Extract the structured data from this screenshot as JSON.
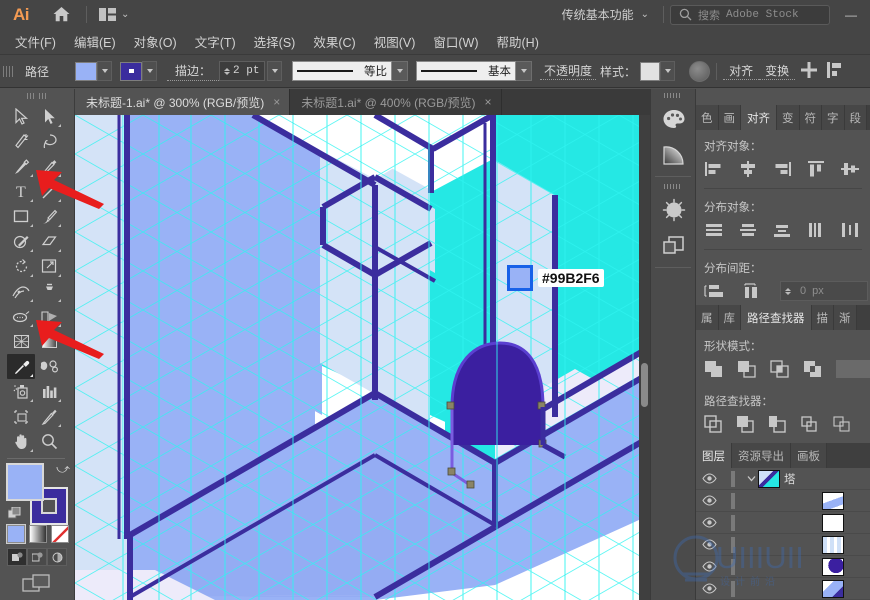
{
  "app": {
    "name": "Ai",
    "logo_color": "#f49b53",
    "home_icon": "home-icon",
    "arrange_icon": "arrange-documents-icon"
  },
  "topbar": {
    "workspace": "传统基本功能",
    "workspace_caret": "chevron-down-icon",
    "search_icon": "search-icon",
    "search_placeholder": "搜索",
    "search_brand": "Adobe Stock",
    "window_buttons": [
      "minimize-button"
    ],
    "minimize_glyph": "—"
  },
  "menubar": {
    "items": [
      {
        "label": "文件(F)",
        "key": "F"
      },
      {
        "label": "编辑(E)",
        "key": "E"
      },
      {
        "label": "对象(O)",
        "key": "O"
      },
      {
        "label": "文字(T)",
        "key": "T"
      },
      {
        "label": "选择(S)",
        "key": "S"
      },
      {
        "label": "效果(C)",
        "key": "C"
      },
      {
        "label": "视图(V)",
        "key": "V"
      },
      {
        "label": "窗口(W)",
        "key": "W"
      },
      {
        "label": "帮助(H)",
        "key": "H"
      }
    ]
  },
  "controlbar": {
    "object_type": "路径",
    "fill_color": "#99B2F6",
    "stroke_color": "#3B2D9E",
    "stroke_label": "描边：",
    "stroke_weight": "2 pt",
    "variable_width_profile": "等比",
    "brush_definition": "基本",
    "opacity_label": "不透明度",
    "style_label": "样式：",
    "style_swatch": "#e2e2e2",
    "recolor_icon": "recolor-artwork-icon",
    "align_label": "对齐",
    "transform_label": "变换",
    "extra_icons": [
      "align-grid-icon",
      "distribute-icon"
    ]
  },
  "tabs": [
    {
      "label": "未标题-1.ai* @ 300% (RGB/预览)",
      "active": true,
      "close": "×"
    },
    {
      "label": "未标题1.ai* @ 400% (RGB/预览)",
      "active": false,
      "close": "×"
    }
  ],
  "toolbar": {
    "tools": [
      {
        "name": "selection-tool",
        "glyph": "arrow-outline",
        "has_flyout": false
      },
      {
        "name": "direct-selection-tool",
        "glyph": "arrow-solid",
        "has_flyout": true
      },
      {
        "name": "magic-wand-tool",
        "glyph": "wand",
        "has_flyout": false
      },
      {
        "name": "lasso-tool",
        "glyph": "lasso",
        "has_flyout": false
      },
      {
        "name": "pen-tool",
        "glyph": "pen",
        "has_flyout": true
      },
      {
        "name": "curvature-tool",
        "glyph": "curvature",
        "has_flyout": true
      },
      {
        "name": "type-tool",
        "glyph": "T",
        "has_flyout": true
      },
      {
        "name": "line-segment-tool",
        "glyph": "line",
        "has_flyout": true
      },
      {
        "name": "rectangle-tool",
        "glyph": "rect",
        "has_flyout": true
      },
      {
        "name": "paintbrush-tool",
        "glyph": "brush",
        "has_flyout": true
      },
      {
        "name": "shaper-tool",
        "glyph": "shaper",
        "has_flyout": true
      },
      {
        "name": "eraser-tool",
        "glyph": "eraser",
        "has_flyout": true
      },
      {
        "name": "rotate-tool",
        "glyph": "rotate",
        "has_flyout": true
      },
      {
        "name": "scale-tool",
        "glyph": "scale",
        "has_flyout": true
      },
      {
        "name": "width-tool",
        "glyph": "width",
        "has_flyout": true
      },
      {
        "name": "free-transform-tool",
        "glyph": "pushpin",
        "has_flyout": true
      },
      {
        "name": "shape-builder-tool",
        "glyph": "shapebuilder",
        "has_flyout": true
      },
      {
        "name": "perspective-grid-tool",
        "glyph": "perspective",
        "has_flyout": true
      },
      {
        "name": "mesh-tool",
        "glyph": "mesh",
        "has_flyout": false
      },
      {
        "name": "gradient-tool",
        "glyph": "gradient",
        "has_flyout": false
      },
      {
        "name": "eyedropper-tool",
        "glyph": "eyedropper",
        "has_flyout": true,
        "selected": true
      },
      {
        "name": "blend-tool",
        "glyph": "blend",
        "has_flyout": true
      },
      {
        "name": "symbol-sprayer-tool",
        "glyph": "sprayer",
        "has_flyout": true
      },
      {
        "name": "column-graph-tool",
        "glyph": "graph",
        "has_flyout": true
      },
      {
        "name": "artboard-tool",
        "glyph": "artboard",
        "has_flyout": false
      },
      {
        "name": "slice-tool",
        "glyph": "slice",
        "has_flyout": true
      },
      {
        "name": "hand-tool",
        "glyph": "hand",
        "has_flyout": true
      },
      {
        "name": "zoom-tool",
        "glyph": "magnifier",
        "has_flyout": false
      }
    ],
    "fill_color": "#99B2F6",
    "stroke_color": "#3B2D9E",
    "swap_icon": "swap-fill-stroke-icon",
    "default_icon": "default-fill-stroke-icon",
    "color_modes": [
      {
        "name": "color-mode",
        "swatch": "#99B2F6"
      },
      {
        "name": "gradient-mode",
        "swatch": "gradient"
      },
      {
        "name": "none-mode",
        "swatch": "none"
      }
    ],
    "draw_modes": [
      "draw-normal",
      "draw-behind",
      "draw-inside"
    ],
    "screen_mode_icon": "change-screen-mode-icon"
  },
  "canvas": {
    "zoom": "300%",
    "background": "#ffffff",
    "grid_color": "#2ff3f0",
    "colors": {
      "cyan": "#25E8E4",
      "periwinkle": "#99B2F6",
      "pale_blue": "#D4E3F7",
      "very_pale": "#EDEBFA",
      "stroke_indigo": "#3B2D9E",
      "door_purple": "#3B1FA0",
      "white": "#ffffff"
    },
    "tooltip": {
      "swatch": "#99B2F6",
      "label": "#99B2F6"
    },
    "annotations": [
      {
        "name": "arrow-to-pen-tool",
        "color": "#E81D1D"
      },
      {
        "name": "arrow-to-shape-builder-tool",
        "color": "#E81D1D"
      }
    ],
    "scrollbar": {
      "name": "vertical-scrollbar"
    }
  },
  "dockstrip": {
    "buttons": [
      {
        "name": "color-panel-icon",
        "glyph": "palette"
      },
      {
        "name": "gradient-panel-icon",
        "glyph": "gradient-fan"
      },
      {
        "name": "brushes-panel-icon",
        "glyph": "brush-circle"
      },
      {
        "name": "layers-panel-icon",
        "glyph": "layers-squares"
      }
    ]
  },
  "align_panel": {
    "tabs": [
      {
        "label": "色",
        "name": "color-tab",
        "active": false
      },
      {
        "label": "画",
        "name": "brushes-tab",
        "active": false
      },
      {
        "label": "对齐",
        "name": "align-tab",
        "active": true
      },
      {
        "label": "变",
        "name": "transform-tab",
        "active": false
      },
      {
        "label": "符",
        "name": "symbols-tab",
        "active": false
      },
      {
        "label": "字",
        "name": "character-tab",
        "active": false
      },
      {
        "label": "段",
        "name": "paragraph-tab",
        "active": false
      }
    ],
    "align_objects_label": "对齐对象：",
    "align_buttons": [
      "align-left-icon",
      "align-horizontal-center-icon",
      "align-right-icon",
      "align-top-icon",
      "align-vertical-center-icon"
    ],
    "distribute_objects_label": "分布对象：",
    "distribute_buttons": [
      "distribute-vertical-top-icon",
      "distribute-vertical-center-icon",
      "distribute-vertical-bottom-icon",
      "distribute-horizontal-left-icon",
      "distribute-horizontal-center-icon"
    ],
    "distribute_spacing_label": "分布间距：",
    "spacing_buttons": [
      "vertical-distribute-space-icon",
      "horizontal-distribute-space-icon"
    ],
    "spacing_value": "0",
    "spacing_unit": "px",
    "spacing_stepper": "stepper-icon"
  },
  "pathfinder_panel": {
    "tabs": [
      {
        "label": "属",
        "name": "properties-tab",
        "active": false
      },
      {
        "label": "库",
        "name": "libraries-tab",
        "active": false
      },
      {
        "label": "路径查找器",
        "name": "pathfinder-tab",
        "active": true
      },
      {
        "label": "描",
        "name": "stroke-tab",
        "active": false
      },
      {
        "label": "渐",
        "name": "gradient-tab",
        "active": false
      }
    ],
    "shape_modes_label": "形状模式：",
    "shape_mode_buttons": [
      "unite-icon",
      "minus-front-icon",
      "intersect-icon",
      "exclude-icon",
      "expand-button"
    ],
    "pathfinders_label": "路径查找器：",
    "pathfinder_buttons": [
      "divide-icon",
      "trim-icon",
      "merge-icon",
      "crop-icon",
      "outline-icon",
      "minus-back-icon"
    ]
  },
  "layers_panel": {
    "tabs": [
      {
        "label": "图层",
        "name": "layers-tab",
        "active": true
      },
      {
        "label": "资源导出",
        "name": "asset-export-tab",
        "active": false
      },
      {
        "label": "画板",
        "name": "artboards-tab",
        "active": false
      }
    ],
    "rows": [
      {
        "name": "塔",
        "eye": "visible",
        "twirl": "expanded",
        "thumb": "tower-thumb",
        "is_group": true
      },
      {
        "name": "",
        "eye": "visible",
        "twirl": "none",
        "thumb": "ramp-thumb",
        "is_group": false
      },
      {
        "name": "",
        "eye": "visible",
        "twirl": "none",
        "thumb": "blank-thumb",
        "is_group": false
      },
      {
        "name": "",
        "eye": "visible",
        "twirl": "none",
        "thumb": "pillars-thumb",
        "is_group": false
      },
      {
        "name": "",
        "eye": "visible",
        "twirl": "none",
        "thumb": "arch-thumb",
        "is_group": false
      },
      {
        "name": "",
        "eye": "visible",
        "twirl": "none",
        "thumb": "panel-thumb",
        "is_group": false
      }
    ]
  },
  "watermark": {
    "text": "UIIIUII",
    "subtext": "设 计 前 沿",
    "color": "#3d6bb5"
  }
}
